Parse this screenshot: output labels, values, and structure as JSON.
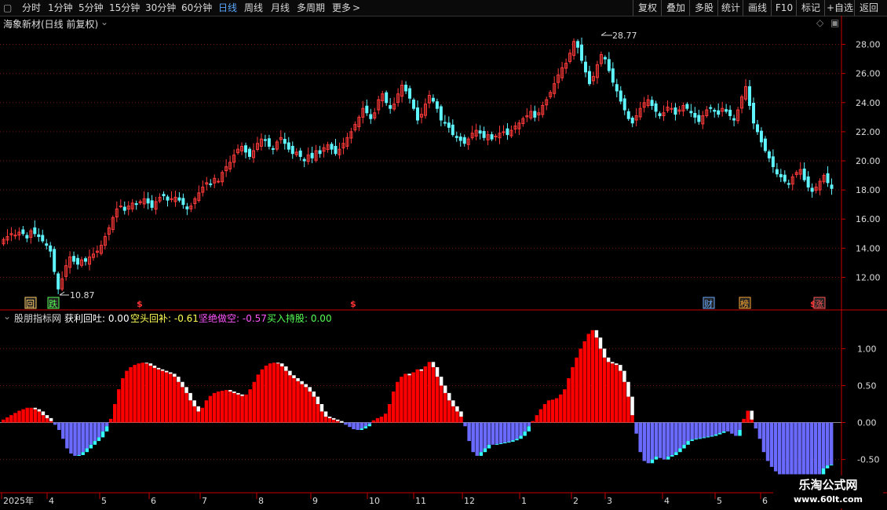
{
  "toolbar": {
    "left": [
      "分时",
      "1分钟",
      "5分钟",
      "15分钟",
      "30分钟",
      "60分钟",
      "日线",
      "周线",
      "月线",
      "多周期",
      "更多"
    ],
    "right": [
      "复权",
      "叠加",
      "多股",
      "统计",
      "画线",
      "F10",
      "标记",
      "+自选",
      "返回"
    ],
    "active": "日线"
  },
  "main_title": "海象新材(日线 前复权)",
  "indicator": {
    "name": "股朋指标网",
    "items": [
      {
        "label": "获利回吐: 0.00",
        "color": "#ffffff"
      },
      {
        "label": "空头回补: -0.61",
        "color": "#ffff55"
      },
      {
        "label": "坚绝做空: -0.57",
        "color": "#ff55ff"
      },
      {
        "label": "买入持股: 0.00",
        "color": "#55ff55"
      }
    ]
  },
  "markers": [
    {
      "text": "回",
      "color": "#ffcc66"
    },
    {
      "text": "跌",
      "color": "#55ff55"
    },
    {
      "text": "$",
      "color": "#ff3333"
    },
    {
      "text": "$",
      "color": "#ff3333"
    },
    {
      "text": "财",
      "color": "#66aaff"
    },
    {
      "text": "榜",
      "color": "#ffaa33"
    },
    {
      "text": "$",
      "color": "#ff3333"
    },
    {
      "text": "涨",
      "color": "#ff5555"
    }
  ],
  "watermark": {
    "main": "乐淘公式网",
    "url": "www.60lt.com"
  },
  "colors": {
    "up": "#ff3a3a",
    "down": "#5ff5ff",
    "grid": "#7a1010",
    "axis": "#c80000",
    "pos": "#ff0000",
    "neg": "#6a6aff",
    "white": "#ffffff",
    "cyan": "#33ffff"
  },
  "chart_data": [
    {
      "type": "candlestick",
      "title": "海象新材(日线 前复权)",
      "ylim": [
        11.0,
        29.0
      ],
      "yticks": [
        "12.00",
        "14.00",
        "16.00",
        "18.00",
        "20.00",
        "22.00",
        "24.00",
        "26.00",
        "28.00"
      ],
      "high_annotation": "28.77",
      "low_annotation": "10.87",
      "closes": [
        14.6,
        14.8,
        15.0,
        14.9,
        15.1,
        15.0,
        14.7,
        15.2,
        15.0,
        14.8,
        14.5,
        14.2,
        13.8,
        12.4,
        11.2,
        11.9,
        12.8,
        13.4,
        13.1,
        12.9,
        13.2,
        13.1,
        13.4,
        13.6,
        13.8,
        14.2,
        14.8,
        15.4,
        16.1,
        16.7,
        16.9,
        16.6,
        16.9,
        17.1,
        17.0,
        17.2,
        17.4,
        17.1,
        16.8,
        17.2,
        17.5,
        17.6,
        17.3,
        17.4,
        17.5,
        17.3,
        17.0,
        16.7,
        16.9,
        17.4,
        17.8,
        18.2,
        18.5,
        18.4,
        18.8,
        18.6,
        19.2,
        19.6,
        19.9,
        20.4,
        20.8,
        21.0,
        20.6,
        20.3,
        20.7,
        21.2,
        21.5,
        21.4,
        21.0,
        20.8,
        21.3,
        21.6,
        21.2,
        20.8,
        20.5,
        20.6,
        20.3,
        20.0,
        20.4,
        20.2,
        20.7,
        20.5,
        20.9,
        21.1,
        20.8,
        20.5,
        20.8,
        21.2,
        21.6,
        22.0,
        22.5,
        23.0,
        23.6,
        23.3,
        22.9,
        23.3,
        24.2,
        24.6,
        24.0,
        23.6,
        23.9,
        24.6,
        25.2,
        24.8,
        24.3,
        23.6,
        22.8,
        23.2,
        23.9,
        24.5,
        24.1,
        23.6,
        22.8,
        22.6,
        22.3,
        21.8,
        21.6,
        21.4,
        21.2,
        21.5,
        21.9,
        22.1,
        21.9,
        21.6,
        21.8,
        21.5,
        21.7,
        21.9,
        22.0,
        21.8,
        22.1,
        22.4,
        22.6,
        22.9,
        23.1,
        23.4,
        23.0,
        23.3,
        23.8,
        24.2,
        24.7,
        25.3,
        25.9,
        26.4,
        26.7,
        27.4,
        28.2,
        27.8,
        26.9,
        26.1,
        25.3,
        25.8,
        26.6,
        27.3,
        27.0,
        26.2,
        25.4,
        24.8,
        24.1,
        23.5,
        22.9,
        22.6,
        23.1,
        23.6,
        24.0,
        24.2,
        23.8,
        23.4,
        23.1,
        23.3,
        23.7,
        23.6,
        23.2,
        23.5,
        23.8,
        23.6,
        23.3,
        23.0,
        22.7,
        23.1,
        23.5,
        23.6,
        23.4,
        23.2,
        23.6,
        23.4,
        23.1,
        22.8,
        23.5,
        24.4,
        25.1,
        23.8,
        22.6,
        22.0,
        21.3,
        20.7,
        20.2,
        19.6,
        19.1,
        18.9,
        18.6,
        18.4,
        18.9,
        19.2,
        19.4,
        18.7,
        18.2,
        17.9,
        18.2,
        18.6,
        19.0,
        18.5,
        18.1
      ]
    },
    {
      "type": "bar",
      "title": "股朋指标网",
      "ylim": [
        -0.78,
        1.45
      ],
      "yticks": [
        "-0.50",
        "0.00",
        "0.50",
        "1.00"
      ],
      "x_labels": [
        "2025年",
        "4",
        "5",
        "6",
        "7",
        "8",
        "9",
        "10",
        "11",
        "12",
        "1",
        "2",
        "3",
        "4",
        "5",
        "6"
      ],
      "values": [
        0.04,
        0.07,
        0.1,
        0.13,
        0.16,
        0.18,
        0.2,
        0.2,
        0.18,
        0.15,
        0.1,
        0.06,
        0.02,
        -0.03,
        -0.1,
        -0.22,
        -0.35,
        -0.42,
        -0.45,
        -0.44,
        -0.4,
        -0.35,
        -0.3,
        -0.25,
        -0.2,
        -0.12,
        -0.05,
        0.05,
        0.25,
        0.45,
        0.6,
        0.7,
        0.75,
        0.78,
        0.8,
        0.81,
        0.8,
        0.77,
        0.74,
        0.72,
        0.7,
        0.68,
        0.66,
        0.62,
        0.55,
        0.48,
        0.4,
        0.3,
        0.22,
        0.15,
        0.2,
        0.3,
        0.36,
        0.4,
        0.42,
        0.43,
        0.44,
        0.42,
        0.4,
        0.38,
        0.36,
        0.38,
        0.45,
        0.55,
        0.65,
        0.72,
        0.77,
        0.8,
        0.81,
        0.8,
        0.76,
        0.7,
        0.64,
        0.6,
        0.56,
        0.52,
        0.48,
        0.42,
        0.35,
        0.25,
        0.15,
        0.08,
        0.06,
        0.04,
        0.02,
        0.0,
        -0.03,
        -0.06,
        -0.09,
        -0.1,
        -0.08,
        -0.05,
        -0.02,
        0.03,
        0.06,
        0.08,
        0.12,
        0.25,
        0.42,
        0.55,
        0.62,
        0.66,
        0.64,
        0.68,
        0.72,
        0.7,
        0.76,
        0.82,
        0.75,
        0.62,
        0.5,
        0.4,
        0.3,
        0.22,
        0.15,
        0.08,
        -0.05,
        -0.25,
        -0.4,
        -0.45,
        -0.4,
        -0.35,
        -0.3,
        -0.3,
        -0.29,
        -0.28,
        -0.27,
        -0.26,
        -0.24,
        -0.22,
        -0.18,
        -0.12,
        -0.05,
        0.02,
        0.1,
        0.18,
        0.25,
        0.3,
        0.31,
        0.33,
        0.38,
        0.45,
        0.6,
        0.75,
        0.88,
        1.0,
        1.1,
        1.2,
        1.25,
        1.15,
        1.0,
        0.88,
        0.82,
        0.8,
        0.78,
        0.7,
        0.55,
        0.35,
        0.1,
        -0.15,
        -0.4,
        -0.52,
        -0.55,
        -0.5,
        -0.46,
        -0.48,
        -0.5,
        -0.46,
        -0.44,
        -0.4,
        -0.35,
        -0.3,
        -0.25,
        -0.23,
        -0.22,
        -0.21,
        -0.2,
        -0.19,
        -0.18,
        -0.16,
        -0.14,
        -0.12,
        -0.12,
        -0.15,
        -0.18,
        -0.1,
        0.05,
        0.16,
        0.04,
        -0.08,
        -0.22,
        -0.4,
        -0.52,
        -0.6,
        -0.66,
        -0.7,
        -0.7,
        -0.7,
        -0.7,
        -0.7,
        -0.7,
        -0.7,
        -0.7,
        -0.7,
        -0.7,
        -0.7,
        -0.62,
        -0.58,
        -0.57
      ]
    }
  ]
}
